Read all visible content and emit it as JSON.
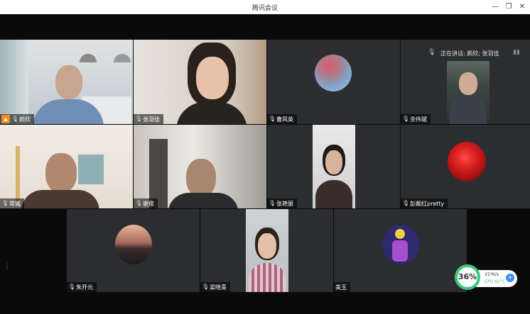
{
  "window": {
    "title": "腾讯会议"
  },
  "speaker": {
    "text": "正在讲话: 颜欣; 张羽佳"
  },
  "participants": [
    {
      "name": "颜欣"
    },
    {
      "name": "张羽佳"
    },
    {
      "name": "曹凤英"
    },
    {
      "name": "余伟斌"
    },
    {
      "name": "常城"
    },
    {
      "name": "谢俊"
    },
    {
      "name": "张艳丽"
    },
    {
      "name": "彭靓红pretty"
    },
    {
      "name": "朱开元"
    },
    {
      "name": "梁晓青"
    },
    {
      "name": "美玉"
    }
  ],
  "perf": {
    "score": "36%",
    "net": "15?K/s",
    "cpu": "CPU 61°C"
  },
  "colors": {
    "active_border": "#3fae49",
    "host_badge": "#f28a18",
    "perf_ring": "#3cc97a",
    "perf_button": "#3b8df2"
  }
}
